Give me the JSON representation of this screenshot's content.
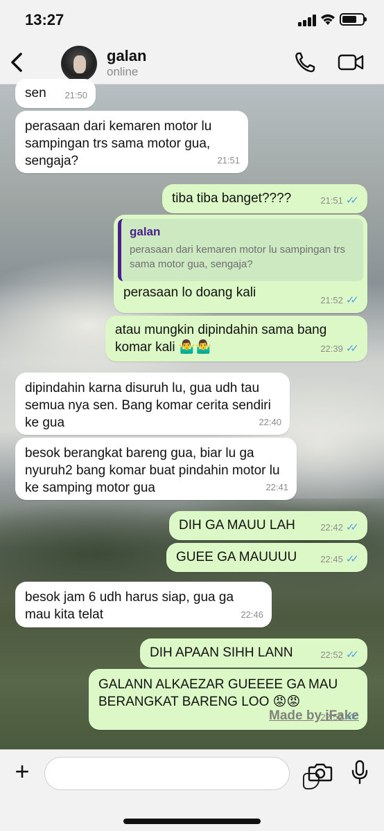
{
  "status_bar": {
    "time": "13:27"
  },
  "contact": {
    "name": "galan",
    "status": "online"
  },
  "messages": [
    {
      "dir": "in",
      "text": "sen",
      "time": "21:50"
    },
    {
      "dir": "in",
      "text": "perasaan dari kemaren motor lu sampingan trs sama motor gua, sengaja?",
      "time": "21:51"
    },
    {
      "dir": "out",
      "text": "tiba tiba banget????",
      "time": "21:51"
    },
    {
      "dir": "out",
      "reply_to_name": "galan",
      "reply_to_text": "perasaan dari kemaren motor lu sampingan trs sama motor gua, sengaja?",
      "text": "perasaan lo doang kali",
      "time": "21:52"
    },
    {
      "dir": "out",
      "text": "atau mungkin dipindahin sama bang komar kali 🤷‍♂️🤷‍♂️",
      "time": "22:39"
    },
    {
      "dir": "in",
      "text": "dipindahin karna disuruh lu, gua udh tau semua nya sen. Bang komar cerita sendiri ke gua",
      "time": "22:40"
    },
    {
      "dir": "in",
      "text": "besok berangkat bareng gua, biar lu ga nyuruh2 bang komar buat pindahin motor lu ke samping motor gua",
      "time": "22:41"
    },
    {
      "dir": "out",
      "text": "DIH GA MAUU LAH",
      "time": "22:42"
    },
    {
      "dir": "out",
      "text": "GUEE GA MAUUUU",
      "time": "22:45"
    },
    {
      "dir": "in",
      "text": "besok jam 6 udh harus siap, gua ga mau kita telat",
      "time": "22:46"
    },
    {
      "dir": "out",
      "text": "DIH APAAN SIHH LANN",
      "time": "22:52"
    },
    {
      "dir": "out",
      "text": "GALANN ALKAEZAR GUEEEE GA MAU BERANGKAT BARENG LOO 😡😡",
      "time": "22:52"
    }
  ],
  "watermark": "Made by iFake",
  "composer": {
    "placeholder": ""
  },
  "icons": {
    "back": "chevron-left-icon",
    "call": "phone-icon",
    "video": "video-icon",
    "attach": "plus-icon",
    "sticker": "sticker-icon",
    "camera": "camera-icon",
    "mic": "mic-icon"
  },
  "colors": {
    "incoming": "#ffffff",
    "outgoing": "#dcf8c6",
    "read_ticks": "#4fa3e6",
    "quote_bar": "#4b1d8f"
  }
}
